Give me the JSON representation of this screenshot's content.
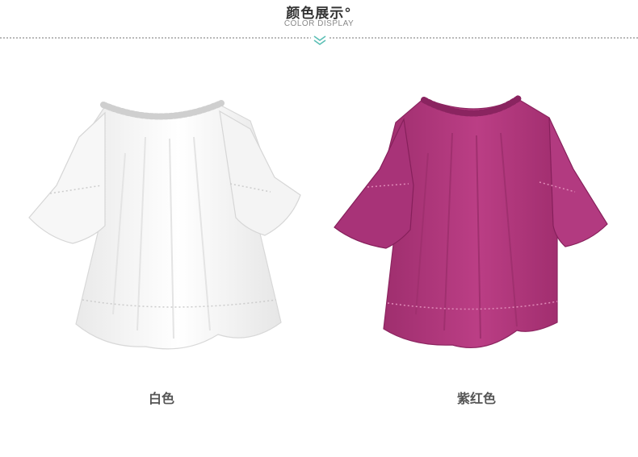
{
  "header": {
    "title": "颜色展示°",
    "subtitle": "COLOR DISPLAY",
    "divider_icon": "double-chevron-down-icon",
    "accent_color": "#5bbfb5"
  },
  "products": [
    {
      "caption": "白色",
      "swatch_color": "#ffffff"
    },
    {
      "caption": "紫红色",
      "swatch_color": "#b5397f"
    }
  ]
}
